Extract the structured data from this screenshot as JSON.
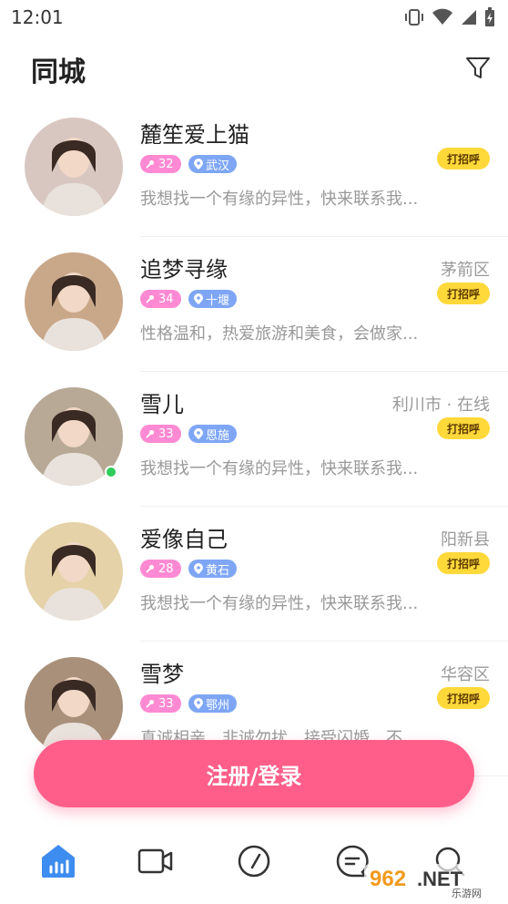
{
  "status": {
    "time": "12:01"
  },
  "header": {
    "title": "同城"
  },
  "users": [
    {
      "name": "麓笙爱上猫",
      "location": "",
      "age": "32",
      "city": "武汉",
      "intro": "我想找一个有缘的异性，快来联系我...",
      "greet": "打招呼",
      "online": false,
      "avatar_bg": "#d8c7c0"
    },
    {
      "name": "追梦寻缘",
      "location": "茅箭区",
      "age": "34",
      "city": "十堰",
      "intro": "性格温和，热爱旅游和美食，会做家...",
      "greet": "打招呼",
      "online": false,
      "avatar_bg": "#c9a789"
    },
    {
      "name": "雪儿",
      "location": "利川市 · 在线",
      "age": "33",
      "city": "恩施",
      "intro": "我想找一个有缘的异性，快来联系我...",
      "greet": "打招呼",
      "online": true,
      "avatar_bg": "#b8a996"
    },
    {
      "name": "爱像自己",
      "location": "阳新县",
      "age": "28",
      "city": "黄石",
      "intro": "我想找一个有缘的异性，快来联系我...",
      "greet": "打招呼",
      "online": false,
      "avatar_bg": "#e5d2a8"
    },
    {
      "name": "雪梦",
      "location": "华容区",
      "age": "33",
      "city": "鄂州",
      "intro": "真诚相亲，非诚勿扰，接受闪婚，不...",
      "greet": "打招呼",
      "online": false,
      "avatar_bg": "#a9907a"
    }
  ],
  "login": {
    "label": "注册/登录"
  },
  "watermark": {
    "text": "962.NET",
    "sub": "乐游网"
  },
  "colors": {
    "accent": "#ff5e8a",
    "greet": "#ffd83a",
    "age": "#ff8ad3",
    "city": "#7ea6f5"
  }
}
